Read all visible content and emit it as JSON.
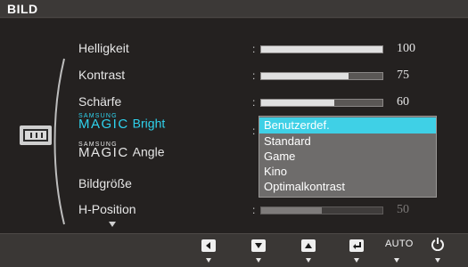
{
  "window": {
    "title": "BILD"
  },
  "menu": {
    "items": [
      {
        "label": "Helligkeit",
        "value": "100",
        "level": 1.0,
        "enabled": true
      },
      {
        "label": "Kontrast",
        "value": "75",
        "level": 0.72,
        "enabled": true
      },
      {
        "label": "Schärfe",
        "value": "60",
        "level": 0.6,
        "enabled": true
      },
      {
        "brand_small": "SAMSUNG",
        "brand_large": "MAGIC",
        "label": "Bright",
        "selected": true
      },
      {
        "brand_small": "SAMSUNG",
        "brand_large": "MAGIC",
        "label": "Angle"
      },
      {
        "label": "Bildgröße"
      },
      {
        "label": "H-Position",
        "value": "50",
        "level": 0.5,
        "enabled": false
      }
    ],
    "more_indicator": "chevron-down-icon"
  },
  "dropdown": {
    "options": [
      "Benutzerdef.",
      "Standard",
      "Game",
      "Kino",
      "Optimalkontrast"
    ],
    "selected": "Benutzerdef."
  },
  "bottom_bar": {
    "buttons": [
      {
        "icon": "arrow-left-icon"
      },
      {
        "icon": "arrow-down-icon"
      },
      {
        "icon": "arrow-up-icon"
      },
      {
        "icon": "enter-icon"
      },
      {
        "label": "AUTO"
      },
      {
        "icon": "power-icon"
      }
    ]
  },
  "colors": {
    "accent": "#3fd0e6",
    "active_text": "#2fd3ee",
    "panel_bg": "#242120"
  }
}
